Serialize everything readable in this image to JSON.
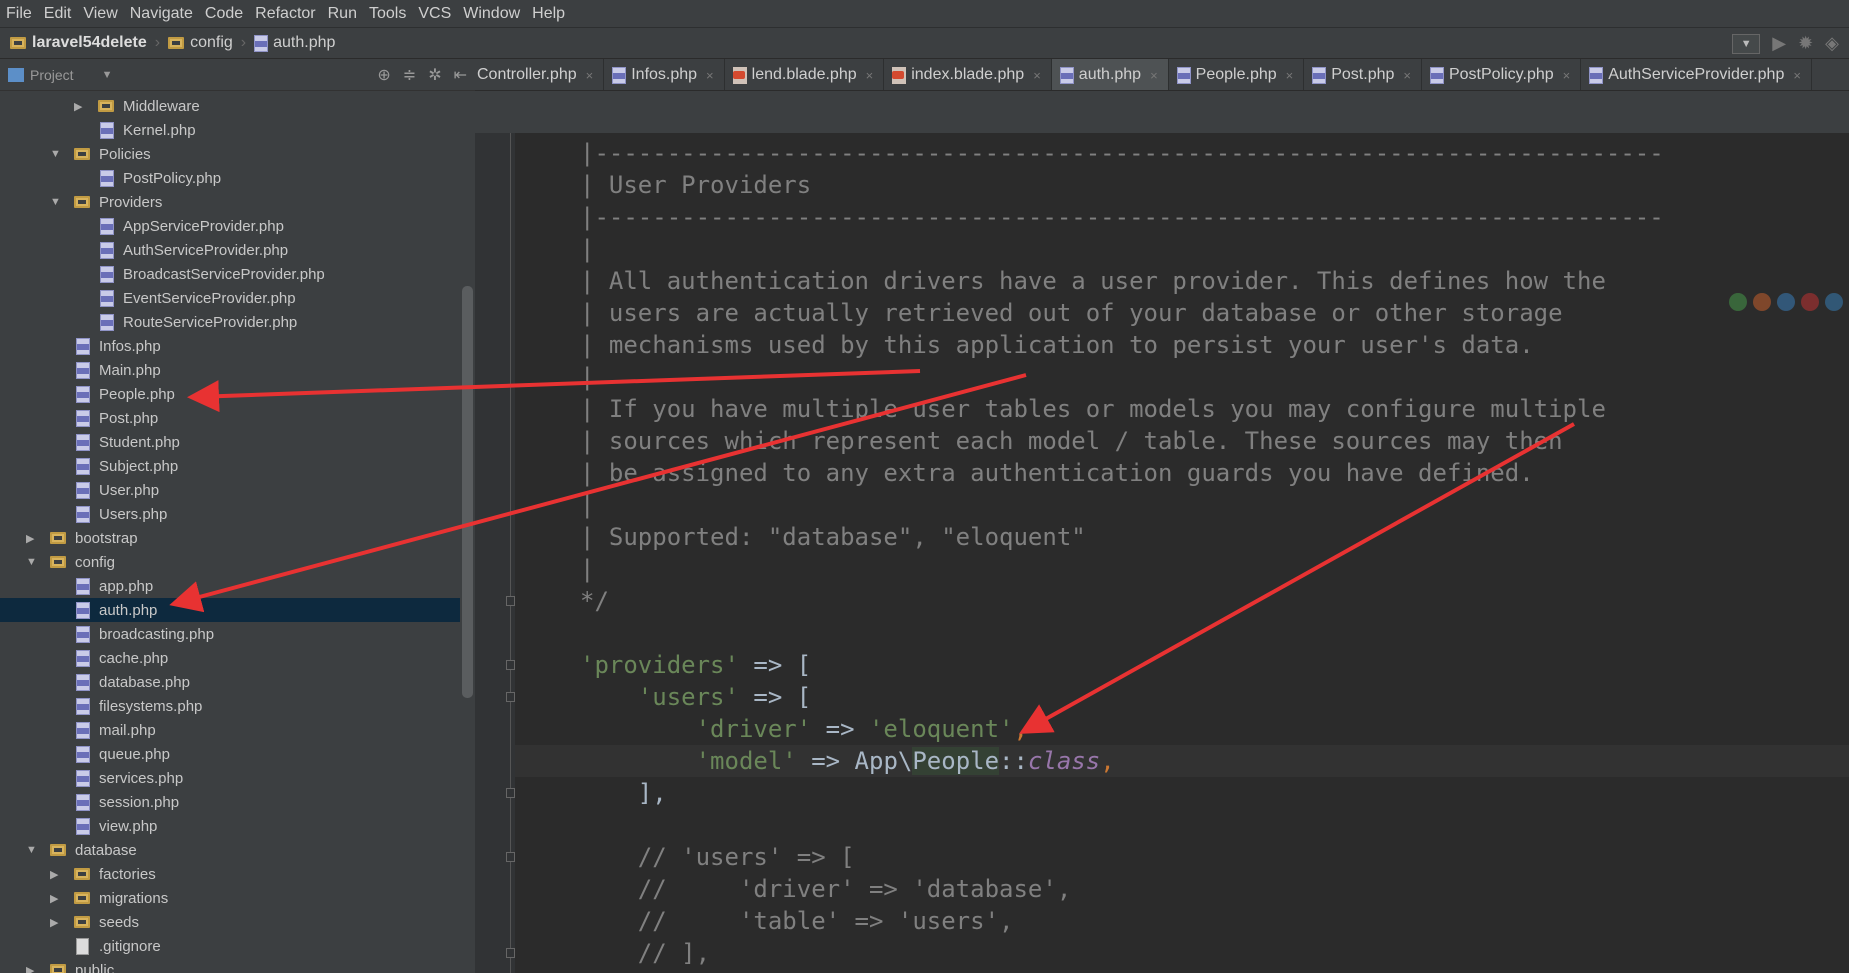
{
  "menu": [
    "File",
    "Edit",
    "View",
    "Navigate",
    "Code",
    "Refactor",
    "Run",
    "Tools",
    "VCS",
    "Window",
    "Help"
  ],
  "breadcrumb": [
    "laravel54delete",
    "config",
    "auth.php"
  ],
  "project_panel": {
    "title": "Project"
  },
  "tree": [
    {
      "label": "Middleware",
      "type": "folder",
      "depth": 2,
      "expanded": false
    },
    {
      "label": "Kernel.php",
      "type": "php",
      "depth": 2
    },
    {
      "label": "Policies",
      "type": "folder",
      "depth": 1,
      "expanded": true
    },
    {
      "label": "PostPolicy.php",
      "type": "php",
      "depth": 2
    },
    {
      "label": "Providers",
      "type": "folder",
      "depth": 1,
      "expanded": true
    },
    {
      "label": "AppServiceProvider.php",
      "type": "php",
      "depth": 2
    },
    {
      "label": "AuthServiceProvider.php",
      "type": "php",
      "depth": 2
    },
    {
      "label": "BroadcastServiceProvider.php",
      "type": "php",
      "depth": 2
    },
    {
      "label": "EventServiceProvider.php",
      "type": "php",
      "depth": 2
    },
    {
      "label": "RouteServiceProvider.php",
      "type": "php",
      "depth": 2
    },
    {
      "label": "Infos.php",
      "type": "php",
      "depth": 1
    },
    {
      "label": "Main.php",
      "type": "php",
      "depth": 1
    },
    {
      "label": "People.php",
      "type": "php",
      "depth": 1
    },
    {
      "label": "Post.php",
      "type": "php",
      "depth": 1
    },
    {
      "label": "Student.php",
      "type": "php",
      "depth": 1
    },
    {
      "label": "Subject.php",
      "type": "php",
      "depth": 1
    },
    {
      "label": "User.php",
      "type": "php",
      "depth": 1
    },
    {
      "label": "Users.php",
      "type": "php",
      "depth": 1
    },
    {
      "label": "bootstrap",
      "type": "folder",
      "depth": 0,
      "expanded": false
    },
    {
      "label": "config",
      "type": "folder",
      "depth": 0,
      "expanded": true
    },
    {
      "label": "app.php",
      "type": "php",
      "depth": 1
    },
    {
      "label": "auth.php",
      "type": "php",
      "depth": 1,
      "selected": true
    },
    {
      "label": "broadcasting.php",
      "type": "php",
      "depth": 1
    },
    {
      "label": "cache.php",
      "type": "php",
      "depth": 1
    },
    {
      "label": "database.php",
      "type": "php",
      "depth": 1
    },
    {
      "label": "filesystems.php",
      "type": "php",
      "depth": 1
    },
    {
      "label": "mail.php",
      "type": "php",
      "depth": 1
    },
    {
      "label": "queue.php",
      "type": "php",
      "depth": 1
    },
    {
      "label": "services.php",
      "type": "php",
      "depth": 1
    },
    {
      "label": "session.php",
      "type": "php",
      "depth": 1
    },
    {
      "label": "view.php",
      "type": "php",
      "depth": 1
    },
    {
      "label": "database",
      "type": "folder",
      "depth": 0,
      "expanded": true
    },
    {
      "label": "factories",
      "type": "folder",
      "depth": 1,
      "expanded": false
    },
    {
      "label": "migrations",
      "type": "folder",
      "depth": 1,
      "expanded": false
    },
    {
      "label": "seeds",
      "type": "folder",
      "depth": 1,
      "expanded": false
    },
    {
      "label": ".gitignore",
      "type": "text",
      "depth": 1
    },
    {
      "label": "public",
      "type": "folder",
      "depth": 0,
      "expanded": false
    }
  ],
  "tabs": [
    {
      "label": "Controller.php",
      "type": "php",
      "active": false
    },
    {
      "label": "Infos.php",
      "type": "php",
      "active": false
    },
    {
      "label": "lend.blade.php",
      "type": "blade",
      "active": false
    },
    {
      "label": "index.blade.php",
      "type": "blade",
      "active": false
    },
    {
      "label": "auth.php",
      "type": "php",
      "active": true
    },
    {
      "label": "People.php",
      "type": "php",
      "active": false
    },
    {
      "label": "Post.php",
      "type": "php",
      "active": false
    },
    {
      "label": "PostPolicy.php",
      "type": "php",
      "active": false
    },
    {
      "label": "AuthServiceProvider.php",
      "type": "php",
      "active": false
    }
  ],
  "code": [
    [
      [
        "|--------------------------------------------------------------------------",
        "c"
      ]
    ],
    [
      [
        "| User Providers",
        "c"
      ]
    ],
    [
      [
        "|--------------------------------------------------------------------------",
        "c"
      ]
    ],
    [
      [
        "|",
        "c"
      ]
    ],
    [
      [
        "| All authentication drivers have a user provider. This defines how the",
        "c"
      ]
    ],
    [
      [
        "| users are actually retrieved out of your database or other storage",
        "c"
      ]
    ],
    [
      [
        "| mechanisms used by this application to persist your user's data.",
        "c"
      ]
    ],
    [
      [
        "|",
        "c"
      ]
    ],
    [
      [
        "| If you have multiple user tables or models you may configure multiple",
        "c"
      ]
    ],
    [
      [
        "| sources which represent each model / table. These sources may then",
        "c"
      ]
    ],
    [
      [
        "| be assigned to any extra authentication guards you have defined.",
        "c"
      ]
    ],
    [
      [
        "|",
        "c"
      ]
    ],
    [
      [
        "| Supported: \"database\", \"eloquent\"",
        "c"
      ]
    ],
    [
      [
        "|",
        "c"
      ]
    ],
    [
      [
        "*/",
        "c"
      ]
    ],
    [],
    [
      [
        "'providers'",
        "s"
      ],
      [
        " => [",
        "p"
      ]
    ],
    [
      [
        "    ",
        "p"
      ],
      [
        "'users'",
        "s"
      ],
      [
        " => [",
        "p"
      ]
    ],
    [
      [
        "        ",
        "p"
      ],
      [
        "'driver'",
        "s"
      ],
      [
        " => ",
        "p"
      ],
      [
        "'eloquent'",
        "s"
      ],
      [
        ",",
        "o"
      ]
    ],
    [
      [
        "        ",
        "p"
      ],
      [
        "'model'",
        "s"
      ],
      [
        " => App\\",
        "p"
      ],
      [
        "People",
        "h"
      ],
      [
        "::",
        "p"
      ],
      [
        "class",
        "k"
      ],
      [
        ",",
        "o"
      ]
    ],
    [
      [
        "    ],",
        "p"
      ]
    ],
    [],
    [
      [
        "    // 'users' => [",
        "c"
      ]
    ],
    [
      [
        "    //     'driver' => 'database',",
        "c"
      ]
    ],
    [
      [
        "    //     'table' => 'users',",
        "c"
      ]
    ],
    [
      [
        "    // ],",
        "c"
      ]
    ]
  ],
  "current_line": 19,
  "accent": "#e83232"
}
